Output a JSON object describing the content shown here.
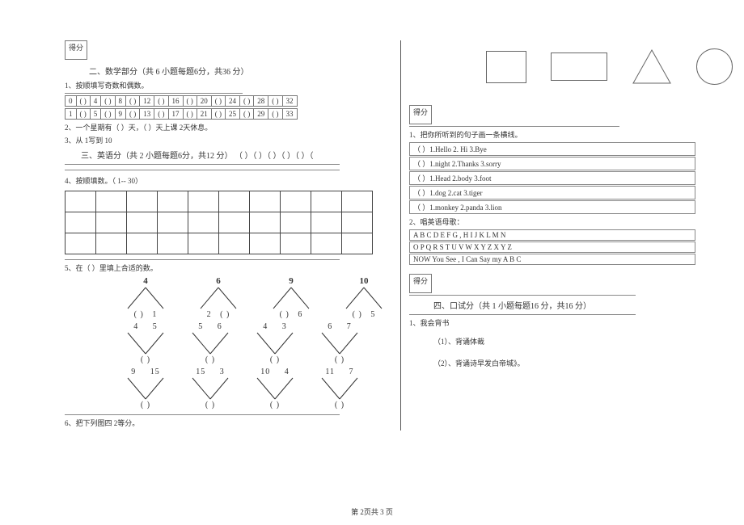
{
  "score_label": "得分",
  "math": {
    "title": "二、数学部分（共  6 小题每题6分，共36 分）",
    "q1": "1、按顺填写奇数和偶数。",
    "row_even": [
      "0",
      "(  )",
      "4",
      "(  )",
      "8",
      "(  )",
      "12",
      "(  )",
      "16",
      "(  )",
      "20",
      "(  )",
      "24",
      "(  )",
      "28",
      "(  )",
      "32"
    ],
    "row_odd": [
      "1",
      "(  )",
      "5",
      "(  )",
      "9",
      "(  )",
      "13",
      "(  )",
      "17",
      "(  )",
      "21",
      "(  )",
      "25",
      "(  )",
      "29",
      "(  )",
      "33"
    ],
    "q2": "2、一个星期有（      ）天，（      ）天上课 2天休息。",
    "q3": "3、从 1写到 10",
    "eng_title": "三、英语分（共  2 小题每题6分，共12 分） （  ）（  ）（  ）（  ）（  ）（",
    "q4": "4、按顺填数。（ 1--  30）",
    "q5": "5、在（     ）里填上合适的数。",
    "trees_top": [
      {
        "top": "4",
        "l": "(  )",
        "r": "1"
      },
      {
        "top": "6",
        "l": "2",
        "r": "(  )"
      },
      {
        "top": "9",
        "l": "(  )",
        "r": "6"
      },
      {
        "top": "10",
        "l": "(  )",
        "r": "5"
      }
    ],
    "trees_mid": [
      {
        "l": "4",
        "r": "5",
        "b": "(  )"
      },
      {
        "l": "5",
        "r": "6",
        "b": "(  )"
      },
      {
        "l": "4",
        "r": "3",
        "b": "(  )"
      },
      {
        "l": "6",
        "r": "7",
        "b": "(  )"
      }
    ],
    "trees_bot": [
      {
        "l": "9",
        "r": "15",
        "b": "(  )"
      },
      {
        "l": "15",
        "r": "3",
        "b": "(  )"
      },
      {
        "l": "10",
        "r": "4",
        "b": "(  )"
      },
      {
        "l": "11",
        "r": "7",
        "b": "(  )"
      }
    ],
    "q6": "6、把下列图四  2等分。"
  },
  "english": {
    "q1": "1、把你所听到的句子画一条横线。",
    "rows": [
      "（     ）1.Hello    2. Hi     3.Bye",
      "（     ）1.night    2.Thanks   3.sorry",
      "（     ）1.Head    2.body    3.foot",
      "（     ）1.dog    2.cat    3.tiger",
      "（     ）1.monkey    2.panda    3.lion"
    ],
    "q2": "2、唱英语母歌：",
    "lines": [
      "A B C D E F G , H I J K L M N",
      "O P Q R S T U V W X Y Z  X Y Z",
      "NOW You See , I Can Say my A B C"
    ]
  },
  "oral": {
    "title": "四、口试分（共  1 小题每题16 分，共16 分）",
    "q1": "1、我会背书",
    "i1": "（1）、背诵体裁",
    "i2": "（2）、背诵诗早发白帝城》。"
  },
  "pager": "第  2页共  3 页"
}
